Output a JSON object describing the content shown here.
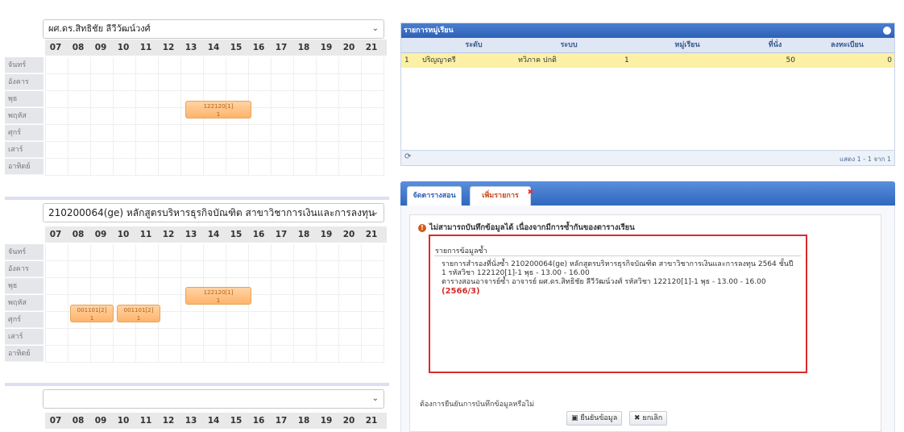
{
  "hours": [
    "07",
    "08",
    "09",
    "10",
    "11",
    "12",
    "13",
    "14",
    "15",
    "16",
    "17",
    "18",
    "19",
    "20",
    "21"
  ],
  "days": [
    "จันทร์",
    "อังคาร",
    "พุธ",
    "พฤหัส",
    "ศุกร์",
    "เสาร์",
    "อาทิตย์"
  ],
  "schedule1": {
    "selected": "ผศ.ดร.สิทธิชัย ลีวีวัฒน์วงศ์",
    "events": [
      {
        "code": "122120[1]",
        "sub": "1"
      }
    ]
  },
  "schedule2": {
    "selected": "210200064(ge) หลักสูตรบริหารธุรกิจบัณฑิต สาขาวิชาการเงินและการลงทุน 2564",
    "events": [
      {
        "code": "001101[2]",
        "sub": "1"
      },
      {
        "code": "001101[2]",
        "sub": "1"
      },
      {
        "code": "122120[1]",
        "sub": "1"
      }
    ]
  },
  "schedule3": {
    "selected": ""
  },
  "panel": {
    "title": "รายการหมู่เรียน",
    "columns": [
      "ระดับ",
      "ระบบ",
      "หมู่เรียน",
      "ที่นั่ง",
      "ลงทะเบียน"
    ],
    "row": {
      "num": "1",
      "level": "ปริญญาตรี",
      "system": "ทวิภาค ปกติ",
      "group": "1",
      "seats": "50",
      "registered": "0"
    },
    "footer_text": "แสดง 1 - 1 จาก 1"
  },
  "tabs": {
    "tab1": "จัดตารางสอน",
    "tab2": "เพิ่มรายการ"
  },
  "error": {
    "title": "ไม่สามารถบันทึกข้อมูลได้ เนื่องจากมีการซ้ำกันของตารางเรียน",
    "box_title": "รายการข้อมูลซ้ำ",
    "line1": "รายการสำรองที่นั่งซ้ำ 210200064(ge) หลักสูตรบริหารธุรกิจบัณฑิต สาขาวิชาการเงินและการลงทุน 2564 ชั้นปี 1 รหัสวิชา 122120[1]-1 พุธ - 13.00 - 16.00",
    "line2": "ตารางสอนอาจารย์ซ้ำ อาจารย์ ผศ.ดร.สิทธิชัย ลีวีวัฒน์วงศ์ รหัสวิชา 122120[1]-1 พุธ - 13.00 - 16.00",
    "term": "(2566/3)"
  },
  "confirm": {
    "question": "ต้องการยืนยันการบันทึกข้อมูลหรือไม่",
    "ok": "ยืนยันข้อมูล",
    "cancel": "ยกเลิก"
  },
  "colors": {
    "accent": "#2c61b8",
    "event": "#ffb46c",
    "row_highlight": "#fbf0a6",
    "error_border": "#d82b2b"
  }
}
